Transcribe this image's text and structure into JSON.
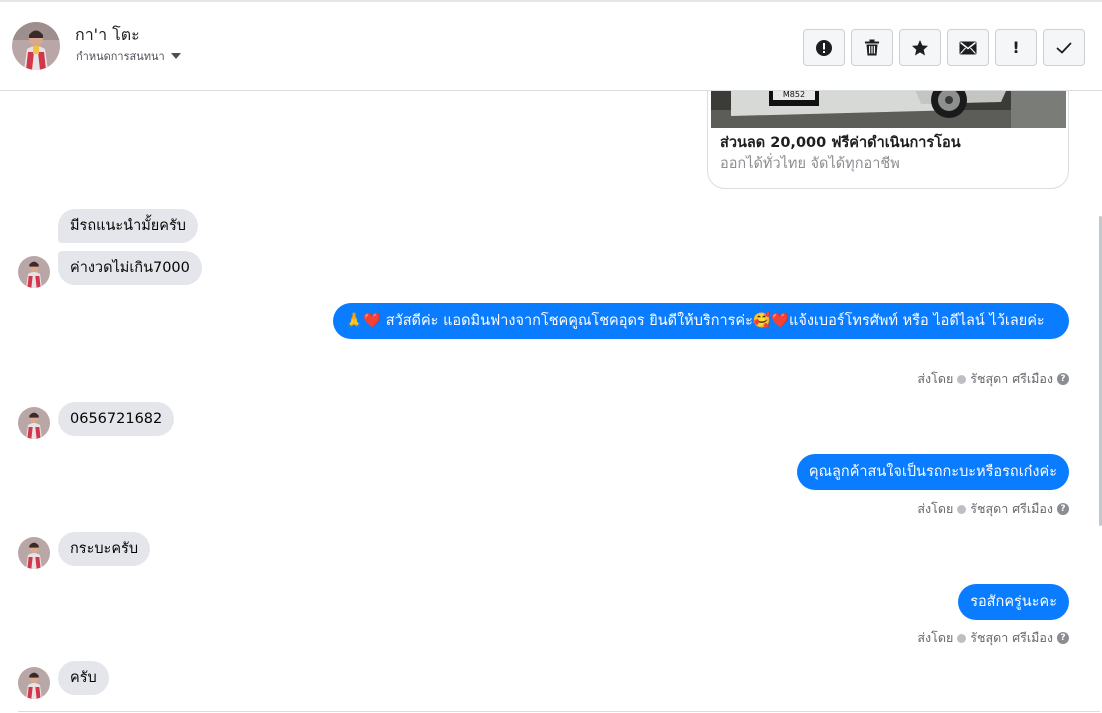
{
  "header": {
    "contact_name": "กา'า โตะ",
    "conversation_settings": "กำหนดการสนทนา",
    "toolbar": {
      "mark_spam_icon": "exclamation-circle-icon",
      "delete_icon": "trash-icon",
      "star_icon": "star-icon",
      "mark_unread_icon": "envelope-icon",
      "follow_up_label": "!",
      "done_icon": "checkmark-icon"
    }
  },
  "ad_card": {
    "title": "ส่วนลด 20,000 ฟรีค่าดำเนินการโอน",
    "subtitle": "ออกได้ทั่วไทย จัดได้ทุกอาชีพ",
    "plate_text": "M852"
  },
  "messages": [
    {
      "direction": "incoming",
      "text": "มีรถแนะนำมั้ยครับ"
    },
    {
      "direction": "incoming",
      "text": "ค่างวดไม่เกิน7000"
    },
    {
      "direction": "outgoing",
      "text": "🙏❤️ สวัสดีค่ะ แอดมินฟางจากโชคคูณโชคอุดร ยินดีให้บริการค่ะ🥰❤️แจ้งเบอร์โทรศัพท์ หรือ ไอดีไลน์  ไว้เลยค่ะ"
    },
    {
      "direction": "incoming",
      "text": "0656721682"
    },
    {
      "direction": "outgoing",
      "text": "คุณลูกค้าสนใจเป็นรถกะบะหรือรถเก๋งค่ะ"
    },
    {
      "direction": "incoming",
      "text": "กระบะครับ"
    },
    {
      "direction": "outgoing",
      "text": "รอสักครู่นะคะ"
    },
    {
      "direction": "incoming",
      "text": "ครับ"
    }
  ],
  "sent_by": {
    "prefix": "ส่งโดย",
    "agent_name": "รัชสุดา ศรีเมือง"
  },
  "colors": {
    "outgoing_bubble": "#0a7cff",
    "incoming_bubble": "#e4e6eb",
    "meta_text": "#65676b"
  }
}
